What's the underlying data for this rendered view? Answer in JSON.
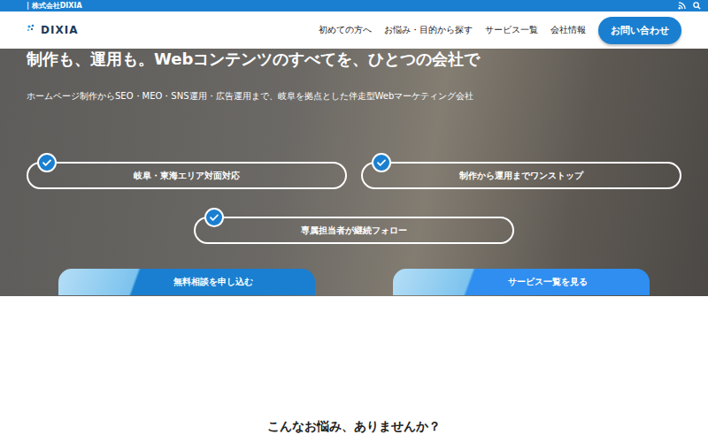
{
  "topbar": {
    "company": "| 株式会社DIXIA"
  },
  "header": {
    "logo": "DIXIA",
    "nav": [
      "初めての方へ",
      "お悩み・目的から探す",
      "サービス一覧",
      "会社情報"
    ],
    "contact_button": "お問い合わせ"
  },
  "hero": {
    "title": "制作も、運用も。Webコンテンツのすべてを、ひとつの会社で",
    "subtitle": "ホームページ制作からSEO・MEO・SNS運用・広告運用まで、岐阜を拠点とした伴走型Webマーケティング会社",
    "features": [
      "岐阜・東海エリア対面対応",
      "制作から運用までワンストップ",
      "専属担当者が継続フォロー"
    ],
    "buttons": [
      "無料相談を申し込む",
      "サービス一覧を見る"
    ]
  },
  "section": {
    "heading": "こんなお悩み、ありませんか？"
  }
}
